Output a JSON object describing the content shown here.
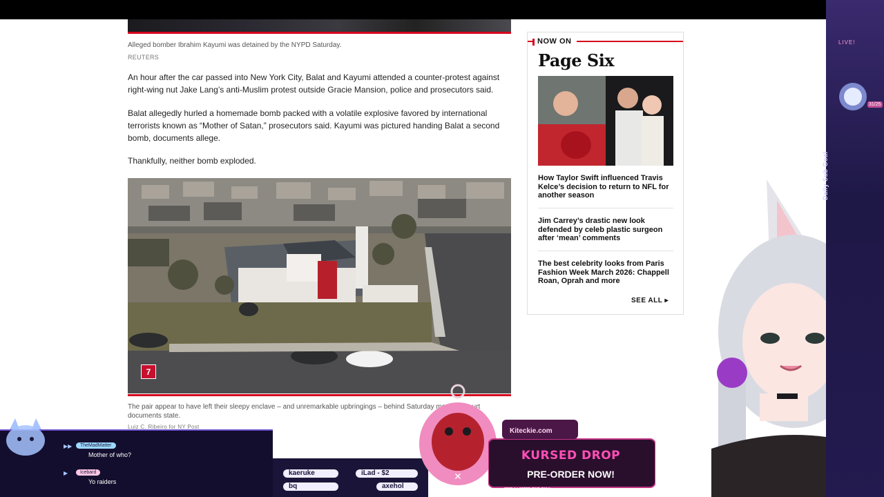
{
  "article": {
    "top_caption": "Alleged bomber Ibrahim Kayumi was detained by the NYPD Saturday.",
    "top_credit": "REUTERS",
    "paragraphs": [
      "An hour after the car passed into New York City, Balat and Kayumi attended a counter-protest against right-wing nut Jake Lang’s anti-Muslim protest outside Gracie Mansion, police and prosecutors said.",
      "Balat allegedly hurled a homemade bomb packed with a volatile explosive favored by international terrorists known as “Mother of Satan,” prosecutors said. Kayumi was pictured handing Balat a second bomb, documents allege.",
      "Thankfully, neither bomb exploded."
    ],
    "photo_badge": "7",
    "bottom_caption": "The pair appear to have left their sleepy enclave – and unremarkable upbringings – behind Saturday morning, court documents state.",
    "bottom_credit": "Luiz C. Ribeiro for NY Post"
  },
  "sidebar": {
    "kicker": "NOW ON",
    "brand": "Page Six",
    "links": [
      "How Taylor Swift influenced Travis Kelce’s decision to return to NFL for another season",
      "Jim Carrey’s drastic new look defended by celeb plastic surgeon after ‘mean’ comments",
      "The best celebrity looks from Paris Fashion Week March 2026: Chappell Roan, Oprah and more"
    ],
    "see_all": "SEE ALL ▸"
  },
  "stream": {
    "live": "LIVE!",
    "goal_label": "Daily Sub Goal",
    "goal_count": "31/25",
    "chat": [
      {
        "user": "TheMadMatter",
        "message": "Mother of who?"
      },
      {
        "user": "Icebard",
        "message": "Yo raiders"
      }
    ],
    "ticker": [
      "kaeruke",
      "iLad - $2",
      "bq",
      "axehol"
    ],
    "merch": {
      "site": "Kiteckie.com",
      "title": "KURSED DROP",
      "cta": "PRE-ORDER NOW!",
      "fine_print": "*FOR A LIMITED TIME ONLY"
    }
  },
  "colors": {
    "accent_red": "#d6001c",
    "stream_purple": "#1e1846",
    "merch_pink": "#ff4fb7"
  }
}
